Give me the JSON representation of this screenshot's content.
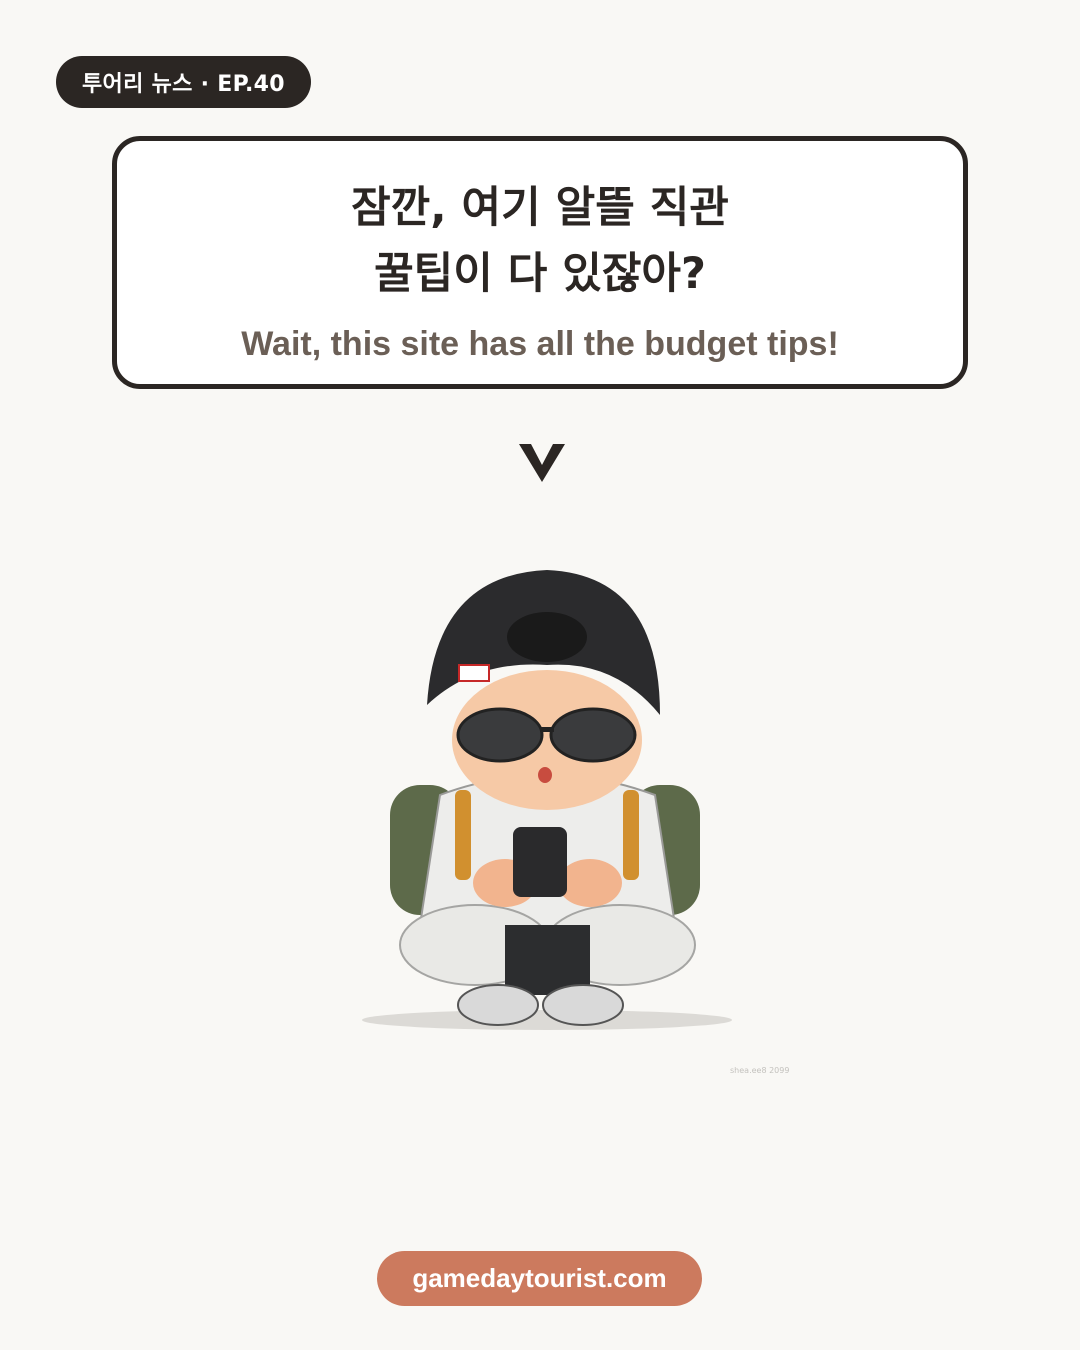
{
  "badge": {
    "label": "투어리 뉴스 · EP.40"
  },
  "speech": {
    "headline_line1": "잠깐, 여기 알뜰 직관",
    "headline_line2": "꿀팁이 다 있잖아?",
    "subline": "Wait, this site has all the budget tips!"
  },
  "icons": {
    "arrow": "chevron-down-icon"
  },
  "illustration": {
    "watermark": "shea.ee8 2099"
  },
  "footer": {
    "url": "gamedaytourist.com"
  },
  "colors": {
    "background": "#f9f8f5",
    "dark": "#2b2623",
    "accent": "#cc7a5e",
    "subtext": "#6b5f56"
  }
}
